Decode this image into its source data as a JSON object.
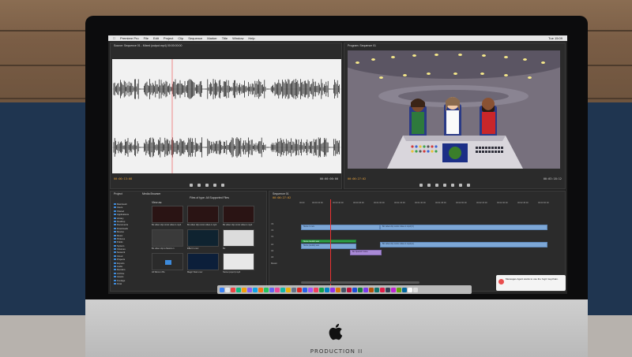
{
  "app": {
    "menu": [
      "Premiere Pro",
      "File",
      "Edit",
      "Project",
      "Clip",
      "Sequence",
      "Marker",
      "Title",
      "Window",
      "Help"
    ],
    "clock": "Tue 15:09"
  },
  "source_panel": {
    "tab": "Source: Sequence 01 - Mixed (output.mp4) 00:00:00:00",
    "timecode_left": "00:00:13:08",
    "timecode_right": "00:00:00:00"
  },
  "program_panel": {
    "tab": "Program: Sequence 01",
    "timecode_left": "00:00:27:02",
    "timecode_right": "00:03:18:12"
  },
  "project_panel": {
    "tabs": [
      "Project",
      "Media Browser"
    ],
    "filter": "Files of type: All Supported Files",
    "view_as": "View as:",
    "folders": [
      "Macintosh",
      "Users",
      "Shared",
      "Applications",
      "Library",
      "Desktop",
      "Documents",
      "Downloads",
      "Movies",
      "Music",
      "Pictures",
      "Public",
      "System",
      "Volumes",
      "Network",
      "Cloud",
      "Projects",
      "Exports",
      "Audio",
      "Renders",
      "Archive",
      "Assets",
      "Footage",
      "Final"
    ],
    "items": [
      {
        "name": "Bo video clip comic video-1.mp4",
        "dur": "1:18"
      },
      {
        "name": "Bo video clip comic video-1.mp4",
        "dur": "1:18"
      },
      {
        "name": "Bo video clip comic video-1.mp4",
        "dur": ""
      },
      {
        "name": "Bo video clip to Mexico 1",
        "dur": "1:18"
      },
      {
        "name": "Effect 1.mov",
        "dur": "1:50"
      },
      {
        "name": "Bo",
        "dur": ""
      },
      {
        "name": "All Skins in Bo",
        "dur": ""
      },
      {
        "name": "Magic Stars.mov",
        "dur": "1:31"
      },
      {
        "name": "Stone (export).mp4",
        "dur": ""
      }
    ]
  },
  "timeline": {
    "tab": "Sequence 01",
    "timecode": "00:00:27:02",
    "ruler": [
      "00:00",
      "00:00:15:00",
      "00:00:30:00",
      "00:00:45:00",
      "00:01:00:00",
      "00:01:15:00",
      "00:01:30:00",
      "00:01:45:00",
      "00:02:00:00",
      "00:02:15:00",
      "00:02:30:00",
      "00:02:45:00",
      "00:03:00:00"
    ],
    "tracks": [
      "V3",
      "V2",
      "V1",
      "A1",
      "A2",
      "A3",
      "Master"
    ],
    "clips": [
      {
        "label": "Stone 1.mov",
        "kind": "video"
      },
      {
        "label": "Stone (audio).wav",
        "kind": "audio"
      },
      {
        "label": "Bo video clip comic video-1.mp4 [V]",
        "kind": "video"
      },
      {
        "label": "Bo video clip comic video-1.mp4 [A]",
        "kind": "audio"
      },
      {
        "label": "Stone (audio).wav",
        "kind": "green"
      },
      {
        "label": "Bo Spanish Voice",
        "kind": "purple"
      }
    ]
  },
  "notification": {
    "text": "Messages Agent wants to use the 'login' keychain."
  },
  "monitor": {
    "brand_label": "PRODUCTION II"
  }
}
